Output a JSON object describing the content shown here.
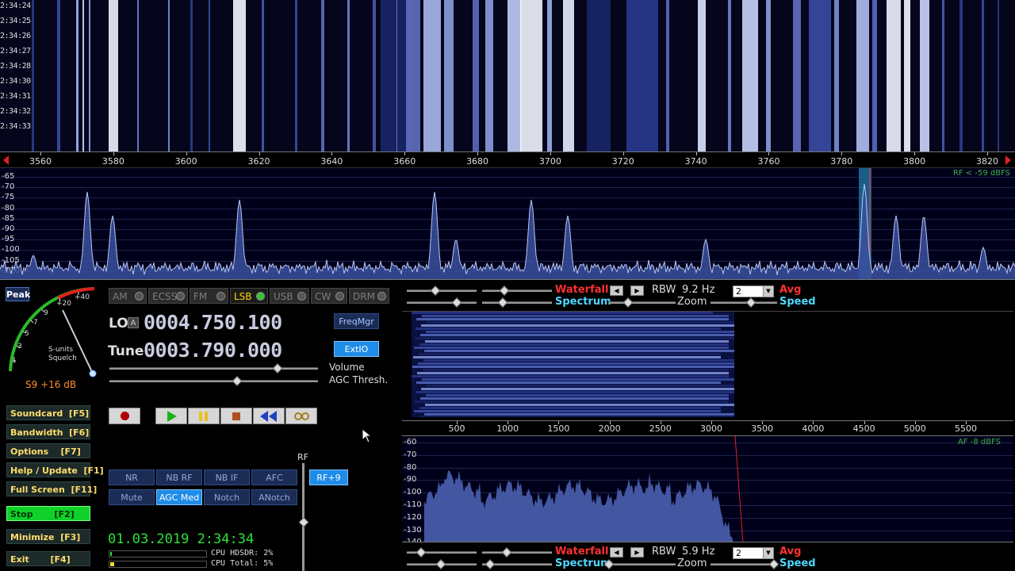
{
  "main_waterfall": {
    "timestamps": [
      "2:34:24",
      "2:34:25",
      "2:34:26",
      "2:34:27",
      "2:34:28",
      "2:34:30",
      "2:34:31",
      "2:34:32",
      "2:34:33"
    ],
    "freq_ticks": [
      "3560",
      "3580",
      "3600",
      "3620",
      "3640",
      "3660",
      "3680",
      "3700",
      "3720",
      "3740",
      "3760",
      "3780",
      "3800",
      "3820"
    ]
  },
  "rf_spectrum": {
    "db_labels": [
      "-65",
      "-70",
      "-75",
      "-80",
      "-85",
      "-90",
      "-95",
      "-100",
      "-105",
      "-110"
    ],
    "note": "RF < -59 dBFS"
  },
  "modes": [
    {
      "label": "AM",
      "active": false
    },
    {
      "label": "ECSS",
      "active": false
    },
    {
      "label": "FM",
      "active": false
    },
    {
      "label": "LSB",
      "active": true
    },
    {
      "label": "USB",
      "active": false
    },
    {
      "label": "CW",
      "active": false
    },
    {
      "label": "DRM",
      "active": false
    }
  ],
  "s_meter": {
    "peak_label": "Peak",
    "scale_labels": [
      "1",
      "3",
      "5",
      "7",
      "9",
      "+20",
      "+40"
    ],
    "center_label_1": "S-units",
    "center_label_2": "Squelch",
    "reading": "S9 +16 dB"
  },
  "lo": {
    "label": "LO",
    "lock": "A",
    "value": "0004.750.100",
    "button": "FreqMgr"
  },
  "tune": {
    "label": "Tune",
    "value": "0003.790.000",
    "button": "ExtIO"
  },
  "volume_label": "Volume",
  "agc_label": "AGC Thresh.",
  "sidebar": {
    "soundcard": "Soundcard  [F5]",
    "bandwidth": "Bandwidth  [F6]",
    "options": "Options    [F7]",
    "help": "Help / Update  [F1]",
    "fullscreen": "Full Screen  [F11]",
    "stop": "Stop       [F2]",
    "minimize": "Minimize  [F3]",
    "exit": "Exit       [F4]"
  },
  "dsp": {
    "row1": [
      "NR",
      "NB RF",
      "NB IF",
      "AFC"
    ],
    "row2": [
      "Mute",
      "AGC Med",
      "Notch",
      "ANotch"
    ],
    "rf_gain_button": "RF+9",
    "rf_label": "RF"
  },
  "datetime": "01.03.2019 2:34:34",
  "cpu": {
    "hdsdr": "CPU HDSDR: 2%",
    "total": "CPU Total: 5%"
  },
  "audio_top_controls": {
    "waterfall": "Waterfall",
    "spectrum": "Spectrum",
    "rbw_label": "RBW",
    "rbw_value": "9.2 Hz",
    "zoom": "Zoom",
    "avg_value": "2",
    "avg": "Avg",
    "speed": "Speed"
  },
  "af_axis": [
    "500",
    "1000",
    "1500",
    "2000",
    "2500",
    "3000",
    "3500",
    "4000",
    "4500",
    "5000",
    "5500"
  ],
  "af_spectrum": {
    "db_labels": [
      "-60",
      "-70",
      "-80",
      "-90",
      "-100",
      "-110",
      "-120",
      "-130",
      "-140"
    ],
    "note": "AF -8 dBFS"
  },
  "audio_bottom_controls": {
    "waterfall": "Waterfall",
    "spectrum": "Spectrum",
    "rbw_label": "RBW",
    "rbw_value": "5.9 Hz",
    "zoom": "Zoom",
    "avg_value": "2",
    "avg": "Avg",
    "speed": "Speed"
  },
  "colors": {
    "accent_blue": "#1f8ce8",
    "stop_green": "#0fd12a",
    "label_red": "#ff3030",
    "label_cyan": "#4fd8ff"
  }
}
